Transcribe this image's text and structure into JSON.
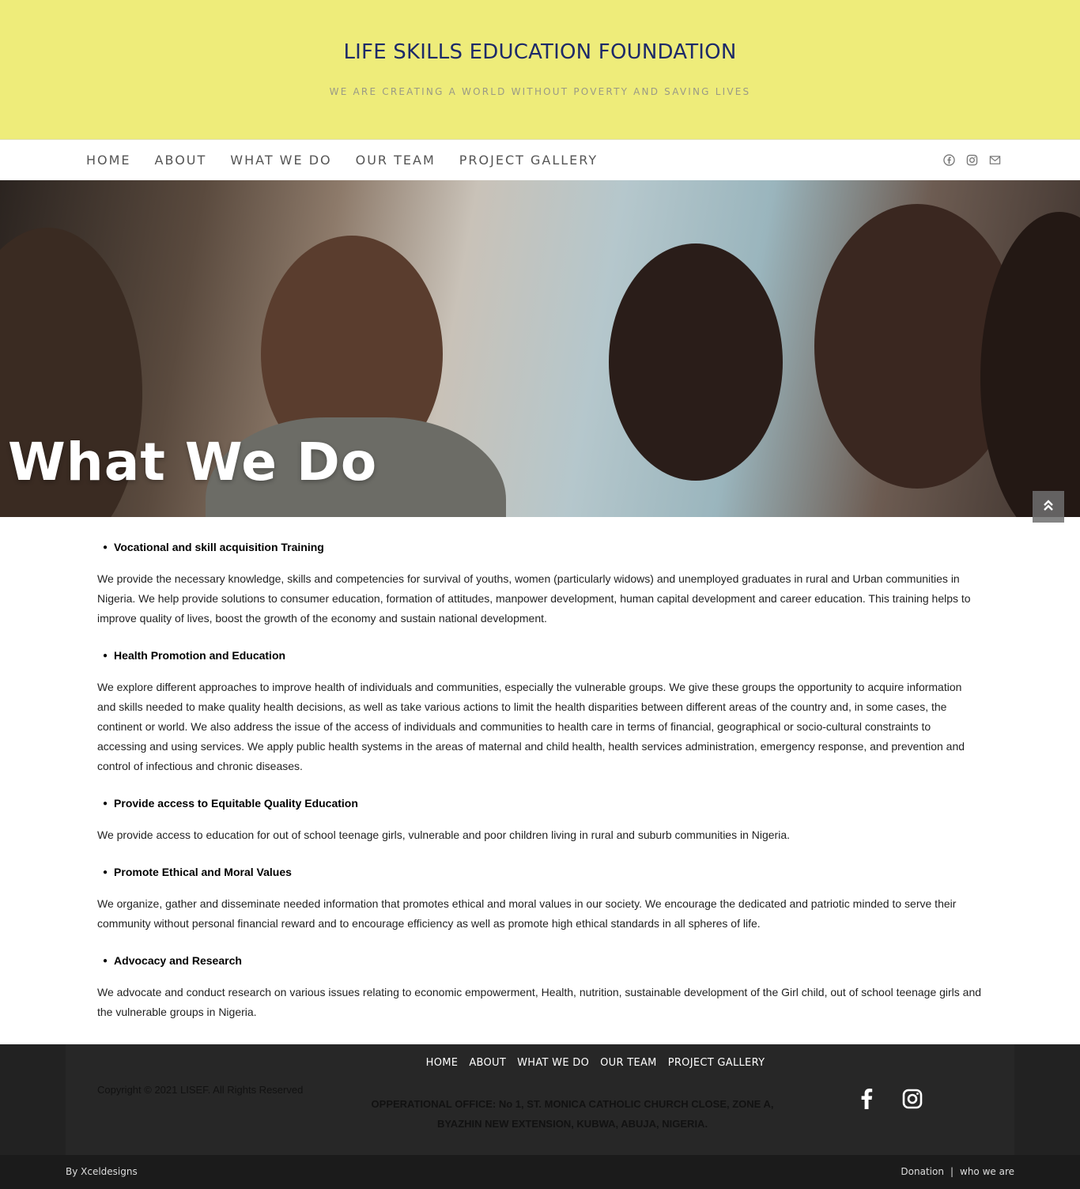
{
  "header": {
    "site_title": "LIFE SKILLS EDUCATION FOUNDATION",
    "tagline": "WE ARE CREATING A WORLD WITHOUT POVERTY AND SAVING LIVES",
    "background_color": "#eeec7a"
  },
  "nav": {
    "items": [
      {
        "label": "HOME"
      },
      {
        "label": "ABOUT"
      },
      {
        "label": "WHAT WE DO"
      },
      {
        "label": "OUR TEAM"
      },
      {
        "label": "PROJECT GALLERY"
      }
    ],
    "social_icons": [
      "facebook-icon",
      "instagram-icon",
      "mail-icon"
    ]
  },
  "hero": {
    "title": "What We Do"
  },
  "sections": [
    {
      "heading": "Vocational and skill acquisition Training",
      "text": "We provide the necessary knowledge, skills and competencies for survival of youths, women (particularly widows) and unemployed graduates in rural and Urban communities in Nigeria. We help provide solutions to consumer education, formation of attitudes, manpower development, human capital development and career education. This training helps to improve quality of lives, boost the growth of the economy and sustain national development."
    },
    {
      "heading": "Health Promotion and Education",
      "text": "We explore different approaches to improve health of individuals and communities, especially the vulnerable groups. We give these groups the opportunity to acquire information and skills needed to make quality health decisions, as well as take various actions to limit the health disparities between different areas of the country and, in some cases, the continent or world. We also address the issue of the access of individuals and communities to health care in terms of financial, geographical or socio-cultural constraints to accessing and using services.  We apply public health systems in the areas of maternal and child health, health services administration, emergency response, and prevention and control of infectious and chronic diseases."
    },
    {
      "heading": "Provide access to Equitable Quality Education",
      "text": "We provide access to education for out of school teenage girls, vulnerable and poor children living in rural and suburb communities in Nigeria."
    },
    {
      "heading": "Promote Ethical and Moral Values",
      "text": "We organize, gather and disseminate needed information that promotes ethical and moral values in our society. We encourage the dedicated and patriotic minded to serve their community without personal financial reward and to encourage efficiency as well as promote high ethical standards in all spheres of life."
    },
    {
      "heading": "Advocacy and Research",
      "text": "We advocate and conduct research on various issues relating to economic empowerment, Health, nutrition, sustainable development of the Girl child, out of school teenage girls and the vulnerable groups in Nigeria."
    }
  ],
  "footer": {
    "menu": [
      "HOME",
      "ABOUT",
      "WHAT WE DO",
      "OUR TEAM",
      "PROJECT GALLERY"
    ],
    "copyright": "Copyright © 2021 LISEF.  All Rights Reserved",
    "office_line1": "OPPERATIONAL OFFICE:  No 1, ST. MONICA CATHOLIC CHURCH CLOSE, ZONE A,",
    "office_line2": "BYAZHIN NEW EXTENSION, KUBWA, ABUJA, NIGERIA.",
    "social_icons": [
      "facebook-icon",
      "instagram-icon"
    ]
  },
  "bottom_bar": {
    "credit": "By Xceldesigns",
    "link_donation": "Donation",
    "separator": "|",
    "link_who": "who we are"
  }
}
